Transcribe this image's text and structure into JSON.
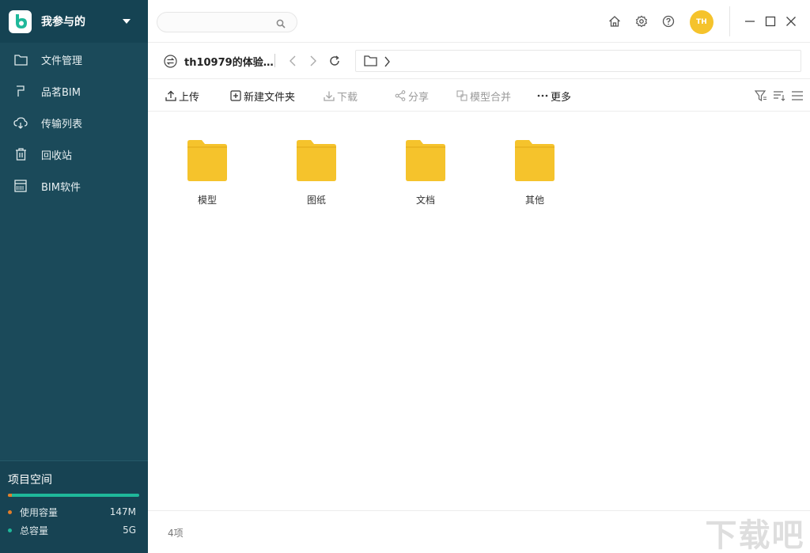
{
  "project": {
    "title": "我参与的"
  },
  "sidebar": {
    "items": [
      {
        "label": "文件管理",
        "icon": "folder-icon"
      },
      {
        "label": "品茗BIM",
        "icon": "brand-icon"
      },
      {
        "label": "传输列表",
        "icon": "cloud-transfer-icon"
      },
      {
        "label": "回收站",
        "icon": "trash-icon"
      },
      {
        "label": "BIM软件",
        "icon": "bim-software-icon"
      }
    ]
  },
  "storage": {
    "title": "项目空间",
    "used_label": "使用容量",
    "used_value": "147M",
    "total_label": "总容量",
    "total_value": "5G",
    "used_fraction": 0.029,
    "used_color": "#e37e2a",
    "total_color": "#1fb89a"
  },
  "search": {
    "placeholder": "",
    "value": ""
  },
  "user": {
    "initials": "TH",
    "avatar_color": "#f5c32c"
  },
  "path": {
    "name": "th10979的体验…"
  },
  "toolbar": {
    "upload": "上传",
    "new_folder": "新建文件夹",
    "download": "下载",
    "share": "分享",
    "merge_model": "模型合并",
    "more": "更多"
  },
  "folders": [
    {
      "name": "模型"
    },
    {
      "name": "图纸"
    },
    {
      "name": "文档"
    },
    {
      "name": "其他"
    }
  ],
  "status": {
    "count": "4项"
  },
  "colors": {
    "sidebar": "#1b4a5a",
    "folder": "#f5c32c",
    "accent": "#1fb89a"
  }
}
